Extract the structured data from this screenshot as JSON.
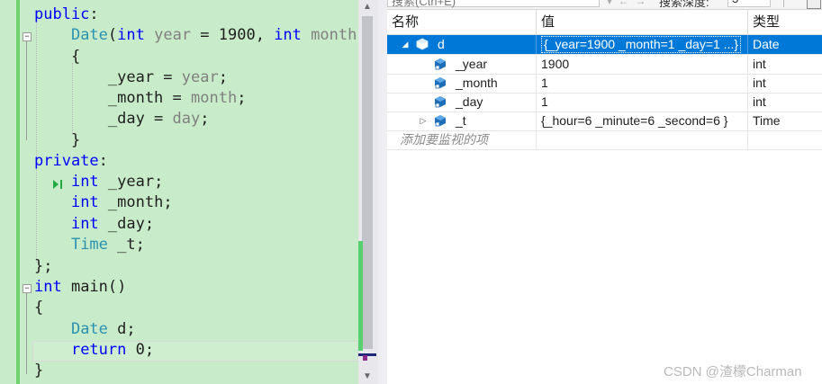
{
  "editor": {
    "lines": [
      {
        "id": "l-public",
        "html": [
          [
            "kw",
            "public"
          ],
          [
            "",
            "{colon}"
          ]
        ]
      },
      {
        "id": "l-ctor",
        "html": [
          [
            "",
            "    "
          ],
          [
            "ty",
            "Date"
          ],
          [
            "",
            "("
          ],
          [
            "kw",
            "int"
          ],
          [
            "pm",
            " year"
          ],
          [
            "",
            " = 1900, "
          ],
          [
            "kw",
            "int"
          ],
          [
            "pm",
            " month"
          ]
        ]
      },
      {
        "id": "l-brace-open",
        "html": [
          [
            "",
            "    {"
          ]
        ]
      },
      {
        "id": "l-year",
        "html": [
          [
            "",
            "        _year = "
          ],
          [
            "pm",
            "year"
          ],
          [
            "",
            ";"
          ]
        ]
      },
      {
        "id": "l-month",
        "html": [
          [
            "",
            "        _month = "
          ],
          [
            "pm",
            "month"
          ],
          [
            "",
            ";"
          ]
        ]
      },
      {
        "id": "l-day",
        "html": [
          [
            "",
            "        _day = "
          ],
          [
            "pm",
            "day"
          ],
          [
            "",
            ";"
          ]
        ]
      },
      {
        "id": "l-brace-close",
        "html": [
          [
            "",
            "    }"
          ]
        ]
      },
      {
        "id": "l-private",
        "html": [
          [
            "kw",
            "private"
          ],
          [
            "",
            "{colon}"
          ]
        ]
      },
      {
        "id": "l-m-year",
        "html": [
          [
            "",
            "    "
          ],
          [
            "kw",
            "int"
          ],
          [
            "",
            " _year;"
          ]
        ]
      },
      {
        "id": "l-m-month",
        "html": [
          [
            "",
            "    "
          ],
          [
            "kw",
            "int"
          ],
          [
            "",
            " _month;"
          ]
        ]
      },
      {
        "id": "l-m-day",
        "html": [
          [
            "",
            "    "
          ],
          [
            "kw",
            "int"
          ],
          [
            "",
            " _day;"
          ]
        ]
      },
      {
        "id": "l-m-t",
        "html": [
          [
            "",
            "    "
          ],
          [
            "ty",
            "Time"
          ],
          [
            "",
            " _t;"
          ]
        ]
      },
      {
        "id": "l-class-end",
        "html": [
          [
            "",
            "};"
          ]
        ]
      },
      {
        "id": "l-main",
        "html": [
          [
            "kw",
            "int"
          ],
          [
            "",
            " main()"
          ]
        ]
      },
      {
        "id": "l-main-open",
        "html": [
          [
            "",
            "{"
          ]
        ]
      },
      {
        "id": "l-decl",
        "html": [
          [
            "",
            "    "
          ],
          [
            "ty",
            "Date"
          ],
          [
            "",
            " d;"
          ]
        ]
      },
      {
        "id": "l-return",
        "html": [
          [
            "",
            "    "
          ],
          [
            "kw",
            "return"
          ],
          [
            "",
            " 0;"
          ]
        ]
      },
      {
        "id": "l-main-close",
        "html": [
          [
            "",
            "}"
          ]
        ]
      }
    ]
  },
  "watch": {
    "toolbar": {
      "search_placeholder": "搜索(Ctrl+E)",
      "depth_label": "搜索深度:",
      "depth_value": "3"
    },
    "columns": {
      "name": "名称",
      "value": "值",
      "type": "类型"
    },
    "rows": [
      {
        "name": "d",
        "value": "{_year=1900 _month=1 _day=1 ...}",
        "type": "Date"
      },
      {
        "name": "_year",
        "value": "1900",
        "type": "int"
      },
      {
        "name": "_month",
        "value": "1",
        "type": "int"
      },
      {
        "name": "_day",
        "value": "1",
        "type": "int"
      },
      {
        "name": "_t",
        "value": "{_hour=6 _minute=6 _second=6 }",
        "type": "Time"
      }
    ],
    "add_item_placeholder": "添加要监视的项"
  },
  "colors": {
    "editor_bg": "#c8ecc9",
    "selection": "#0078d7",
    "keyword": "#0000ff",
    "type": "#2b91af"
  },
  "watermark": "CSDN @渣檬Charman"
}
